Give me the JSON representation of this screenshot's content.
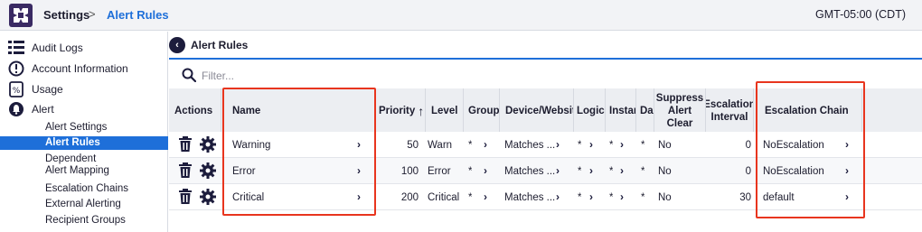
{
  "topbar": {
    "breadcrumb_root": "Settings",
    "breadcrumb_sep": ">",
    "breadcrumb_current": "Alert Rules",
    "timezone": "GMT-05:00 (CDT)"
  },
  "sidebar": {
    "items": [
      {
        "label": "Audit Logs",
        "icon": "audit-log-icon"
      },
      {
        "label": "Account Information",
        "icon": "info-icon"
      },
      {
        "label": "Usage",
        "icon": "percent-icon"
      },
      {
        "label": "Alert",
        "icon": "alert-icon"
      }
    ],
    "subitems": [
      {
        "label": "Alert Settings"
      },
      {
        "label": "Alert Rules",
        "active": true
      },
      {
        "label": "Dependent Alert Mapping"
      },
      {
        "label": "Escalation Chains"
      },
      {
        "label": "External Alerting"
      },
      {
        "label": "Recipient Groups"
      }
    ]
  },
  "main": {
    "title": "Alert Rules",
    "filter_placeholder": "Filter..."
  },
  "table": {
    "headers": {
      "actions": "Actions",
      "name": "Name",
      "priority": "Priority",
      "level": "Level",
      "group": "Group",
      "device": "Device/Website",
      "logic": "LogicM",
      "instance": "Instan",
      "datapoint": "Da",
      "suppress": "Suppress Alert Clear",
      "escalation_interval": "Escalation Interval",
      "escalation_chain": "Escalation Chain"
    },
    "sort_indicator": "↑",
    "rows": [
      {
        "name": "Warning",
        "priority": "50",
        "level": "Warn",
        "group": "*",
        "device": "Matches ...",
        "logic": "*",
        "instance": "*",
        "datapoint": "*",
        "suppress": "No",
        "interval": "0",
        "chain": "NoEscalation"
      },
      {
        "name": "Error",
        "priority": "100",
        "level": "Error",
        "group": "*",
        "device": "Matches ...",
        "logic": "*",
        "instance": "*",
        "datapoint": "*",
        "suppress": "No",
        "interval": "0",
        "chain": "NoEscalation"
      },
      {
        "name": "Critical",
        "priority": "200",
        "level": "Critical",
        "group": "*",
        "device": "Matches ...",
        "logic": "*",
        "instance": "*",
        "datapoint": "*",
        "suppress": "No",
        "interval": "30",
        "chain": "default"
      }
    ]
  },
  "colors": {
    "accent": "#1e6fd9",
    "highlight": "#e8351e",
    "dark": "#1c1c3c"
  }
}
